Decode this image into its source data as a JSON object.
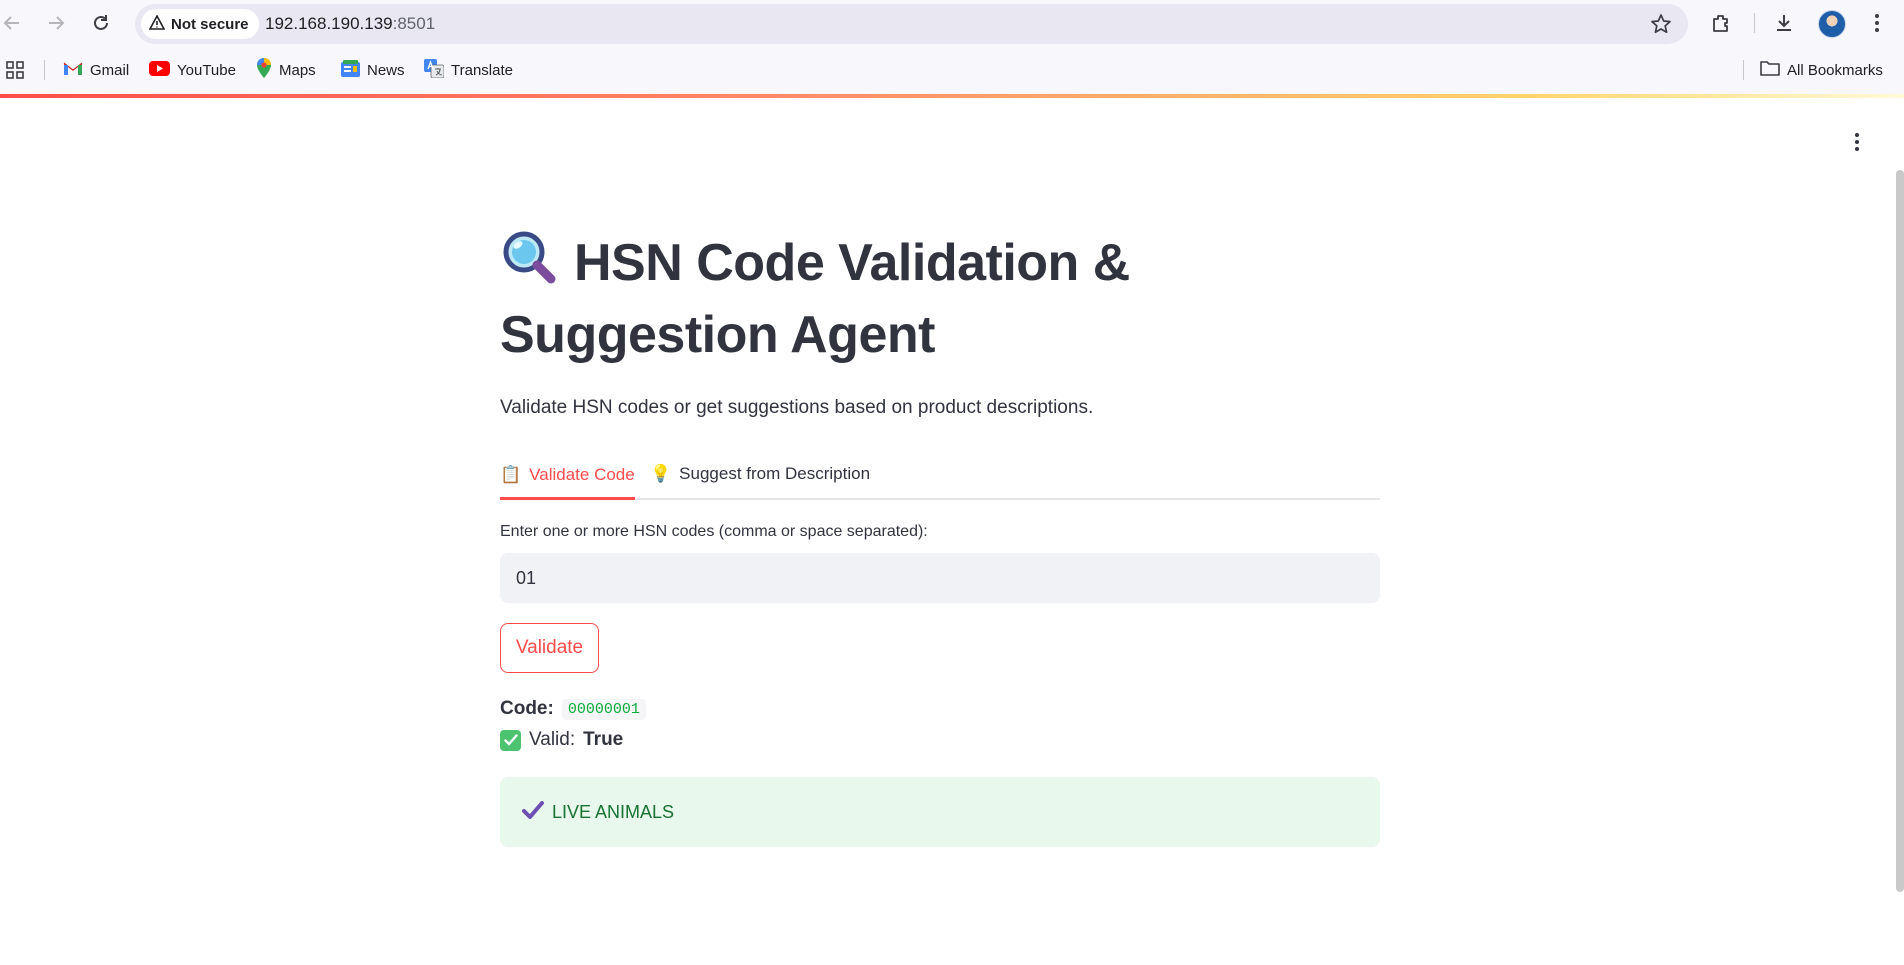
{
  "browser": {
    "security_label": "Not secure",
    "url_host": "192.168.190.139",
    "url_port": ":8501",
    "bookmarks": [
      {
        "label": "Gmail",
        "icon": "gmail-icon"
      },
      {
        "label": "YouTube",
        "icon": "youtube-icon"
      },
      {
        "label": "Maps",
        "icon": "maps-icon"
      },
      {
        "label": "News",
        "icon": "news-icon"
      },
      {
        "label": "Translate",
        "icon": "translate-icon"
      }
    ],
    "all_bookmarks_label": "All Bookmarks"
  },
  "page": {
    "title_emoji": "🔍",
    "title": "HSN Code Validation & Suggestion Agent",
    "subtitle": "Validate HSN codes or get suggestions based on product descriptions.",
    "tabs": [
      {
        "emoji": "📋",
        "label": "Validate Code",
        "active": true
      },
      {
        "emoji": "💡",
        "label": "Suggest from Description",
        "active": false
      }
    ],
    "input_label": "Enter one or more HSN codes (comma or space separated):",
    "input_value": "01",
    "validate_button": "Validate",
    "result": {
      "code_label": "Code:",
      "code_value": "00000001",
      "valid_label": "Valid:",
      "valid_value": "True",
      "description": "LIVE ANIMALS"
    }
  },
  "colors": {
    "accent": "#ff4b4b",
    "success_bg": "#e8f8ec",
    "success_text": "#177233",
    "code_text": "#09ab3b"
  }
}
